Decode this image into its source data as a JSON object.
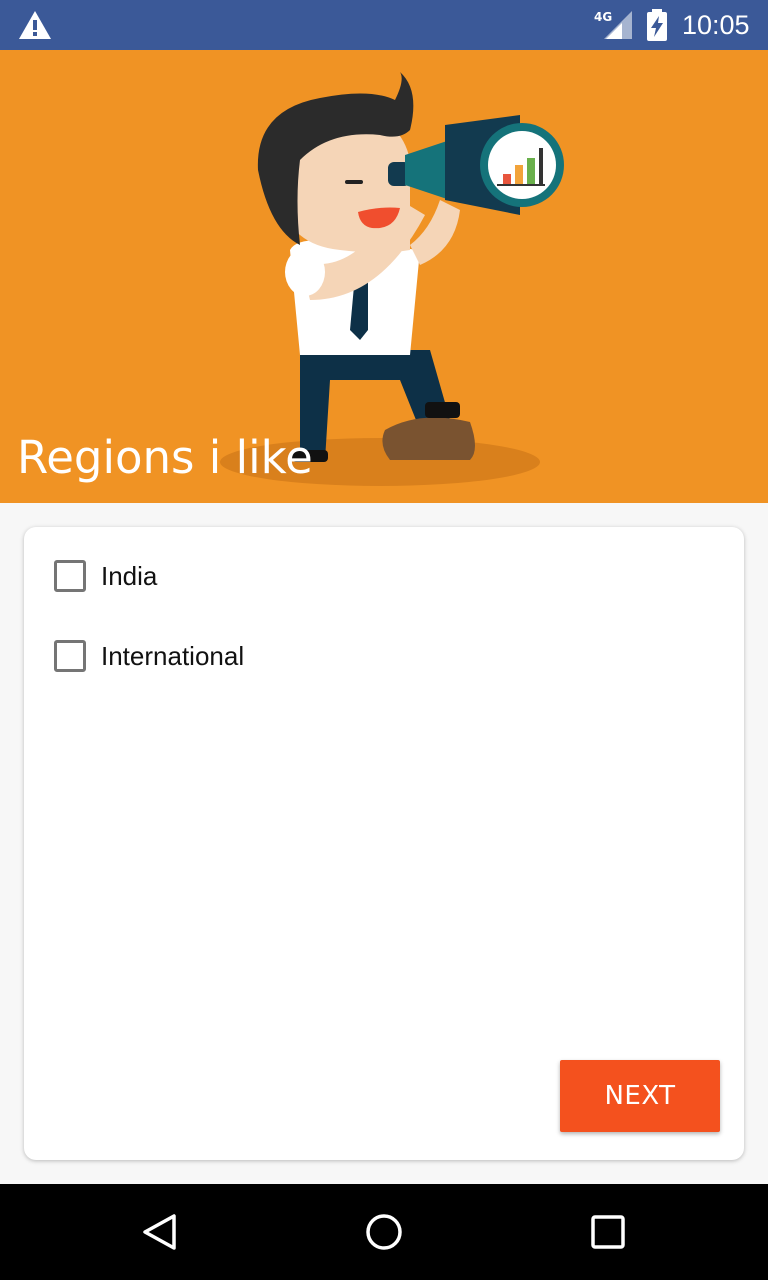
{
  "status_bar": {
    "network": "4G",
    "time": "10:05",
    "icons": [
      "warning-icon",
      "signal-icon",
      "battery-charging-icon"
    ],
    "color": "#3b5998"
  },
  "hero": {
    "title": "Regions i like",
    "background": "#f09324",
    "illustration": "man-with-telescope"
  },
  "options": [
    {
      "label": "India",
      "checked": false
    },
    {
      "label": "International",
      "checked": false
    }
  ],
  "actions": {
    "next_label": "NEXT",
    "next_color": "#f4511e"
  },
  "nav_bar": {
    "icons": [
      "back-icon",
      "home-icon",
      "recents-icon"
    ]
  }
}
